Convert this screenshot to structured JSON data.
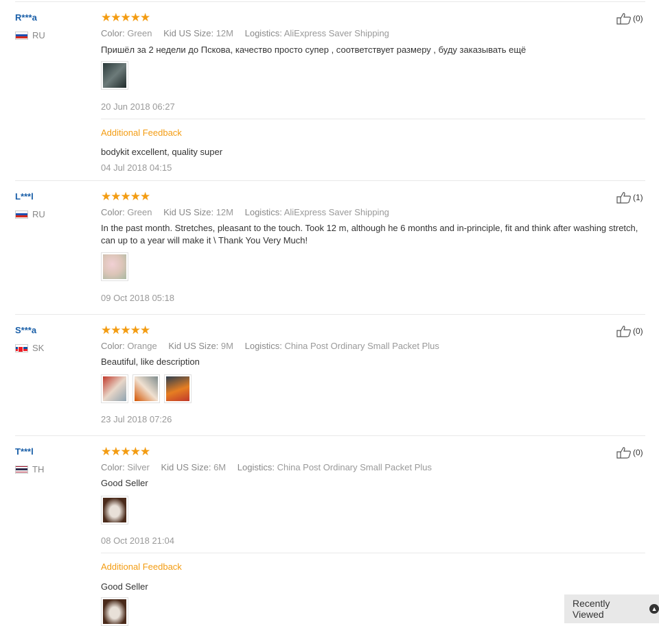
{
  "labels": {
    "color": "Color:",
    "size": "Kid US Size:",
    "logistics": "Logistics:",
    "additional_feedback": "Additional Feedback",
    "stars": "★★★★★",
    "recently_viewed": "Recently Viewed"
  },
  "reviews": [
    {
      "user": "R***a",
      "country": "RU",
      "rating": 5,
      "likes": "(0)",
      "color": "Green",
      "size": "12M",
      "logistics": "AliExpress Saver Shipping",
      "text": "Пришёл за 2 недели до Пскова, качество просто супер , соответствует размеру , буду заказывать ещё",
      "date": "20 Jun 2018 06:27",
      "additional_text": "bodykit excellent, quality super",
      "additional_date": "04 Jul 2018 04:15"
    },
    {
      "user": "L***l",
      "country": "RU",
      "rating": 5,
      "likes": "(1)",
      "color": "Green",
      "size": "12M",
      "logistics": "AliExpress Saver Shipping",
      "text": "In the past month. Stretches, pleasant to the touch. Took 12 m, although he 6 months and in-principle, fit and think after washing stretch, can up to a year will make it \\ Thank You Very Much!",
      "date": "09 Oct 2018 05:18"
    },
    {
      "user": "S***a",
      "country": "SK",
      "rating": 5,
      "likes": "(0)",
      "color": "Orange",
      "size": "9M",
      "logistics": "China Post Ordinary Small Packet Plus",
      "text": "Beautiful, like description",
      "date": "23 Jul 2018 07:26"
    },
    {
      "user": "T***l",
      "country": "TH",
      "rating": 5,
      "likes": "(0)",
      "color": "Silver",
      "size": "6M",
      "logistics": "China Post Ordinary Small Packet Plus",
      "text": "Good Seller",
      "date": "08 Oct 2018 21:04",
      "additional_text": "Good Seller"
    }
  ],
  "colors": {
    "star": "#f39c12",
    "username": "#1a5fa8",
    "additional_feedback": "#f39c12"
  }
}
